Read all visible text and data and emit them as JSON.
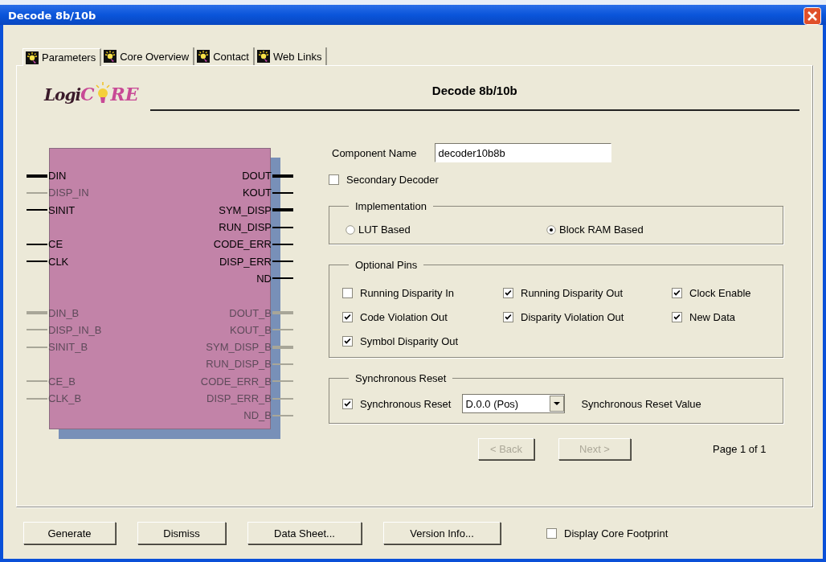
{
  "window": {
    "title": "Decode 8b/10b"
  },
  "tabs": [
    {
      "label": "Parameters",
      "selected": true
    },
    {
      "label": "Core Overview",
      "selected": false
    },
    {
      "label": "Contact",
      "selected": false
    },
    {
      "label": "Web Links",
      "selected": false
    }
  ],
  "logo": {
    "prefix": "Logi",
    "core_start": "C",
    "core_end": "RE"
  },
  "heading": "Decode 8b/10b",
  "symbol": {
    "left_sections": [
      [
        [
          {
            "name": "DIN",
            "bus": true,
            "disabled": false
          },
          {
            "name": "DISP_IN",
            "bus": false,
            "disabled": true
          },
          {
            "name": "SINIT",
            "bus": false,
            "disabled": false
          }
        ],
        [
          {
            "name": "CE",
            "bus": false,
            "disabled": false
          },
          {
            "name": "CLK",
            "bus": false,
            "disabled": false
          }
        ]
      ],
      [
        [
          {
            "name": "DIN_B",
            "bus": true,
            "disabled": true
          },
          {
            "name": "DISP_IN_B",
            "bus": false,
            "disabled": true
          },
          {
            "name": "SINIT_B",
            "bus": false,
            "disabled": true
          }
        ],
        [
          {
            "name": "CE_B",
            "bus": false,
            "disabled": true
          },
          {
            "name": "CLK_B",
            "bus": false,
            "disabled": true
          }
        ]
      ]
    ],
    "right_sections": [
      [
        [
          {
            "name": "DOUT",
            "bus": true,
            "disabled": false
          },
          {
            "name": "KOUT",
            "bus": false,
            "disabled": false
          },
          {
            "name": "SYM_DISP",
            "bus": true,
            "disabled": false
          },
          {
            "name": "RUN_DISP",
            "bus": false,
            "disabled": false
          },
          {
            "name": "CODE_ERR",
            "bus": false,
            "disabled": false
          },
          {
            "name": "DISP_ERR",
            "bus": false,
            "disabled": false
          },
          {
            "name": "ND",
            "bus": false,
            "disabled": false
          }
        ]
      ],
      [
        [
          {
            "name": "DOUT_B",
            "bus": true,
            "disabled": true
          },
          {
            "name": "KOUT_B",
            "bus": false,
            "disabled": true
          },
          {
            "name": "SYM_DISP_B",
            "bus": true,
            "disabled": true
          },
          {
            "name": "RUN_DISP_B",
            "bus": false,
            "disabled": true
          },
          {
            "name": "CODE_ERR_B",
            "bus": false,
            "disabled": true
          },
          {
            "name": "DISP_ERR_B",
            "bus": false,
            "disabled": true
          },
          {
            "name": "ND_B",
            "bus": false,
            "disabled": true
          }
        ]
      ]
    ]
  },
  "component_name": {
    "label": "Component Name",
    "value": "decoder10b8b"
  },
  "secondary_decoder": {
    "label": "Secondary Decoder",
    "checked": false
  },
  "implementation": {
    "title": "Implementation",
    "options": [
      {
        "label": "LUT Based",
        "selected": false
      },
      {
        "label": "Block RAM Based",
        "selected": true
      }
    ]
  },
  "optional_pins": {
    "title": "Optional Pins",
    "items": [
      {
        "label": "Running Disparity In",
        "checked": false
      },
      {
        "label": "Running Disparity Out",
        "checked": true
      },
      {
        "label": "Clock Enable",
        "checked": true
      },
      {
        "label": "Code Violation Out",
        "checked": true
      },
      {
        "label": "Disparity Violation Out",
        "checked": true
      },
      {
        "label": "New Data",
        "checked": true
      },
      {
        "label": "Symbol Disparity Out",
        "checked": true
      }
    ]
  },
  "synchronous_reset": {
    "title": "Synchronous Reset",
    "checkbox": {
      "label": "Synchronous Reset",
      "checked": true
    },
    "dropdown": {
      "value": "D.0.0 (Pos)"
    },
    "value_label": "Synchronous Reset Value"
  },
  "navigation": {
    "buttons": [
      {
        "label": "< Back",
        "disabled": true
      },
      {
        "label": "Next >",
        "disabled": true
      }
    ],
    "page": "Page 1 of 1"
  },
  "footer": {
    "buttons": [
      "Generate",
      "Dismiss",
      "Data Sheet...",
      "Version Info..."
    ],
    "footprint": {
      "label": "Display Core Footprint",
      "checked": false
    }
  }
}
